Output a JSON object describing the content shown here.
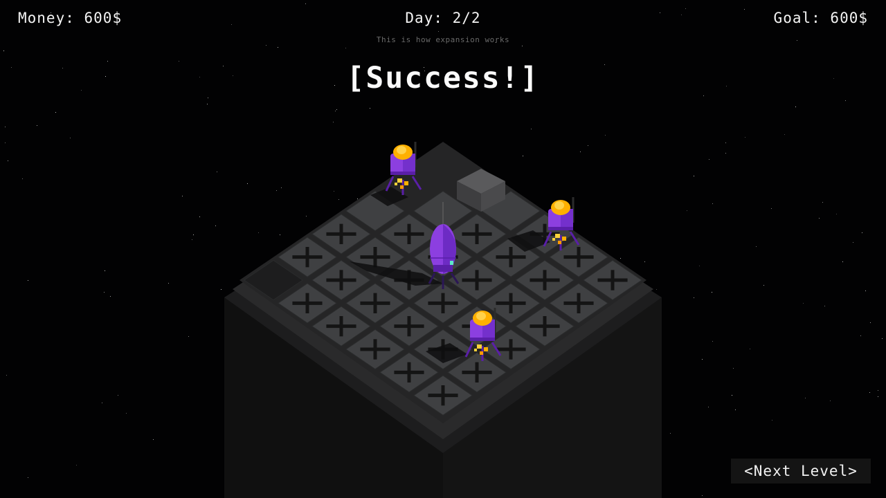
{
  "hud": {
    "money_label": "Money:",
    "money_value": "600$",
    "day_label": "Day:",
    "day_value": "2/2",
    "goal_label": "Goal:",
    "goal_value": "600$",
    "subtitle": "This is how expansion works"
  },
  "result_text": "[Success!]",
  "next_level_label": "<Next Level>",
  "board": {
    "size": 6,
    "unlocked_tiles": 19,
    "marked_tiles": 17,
    "block_count": 1,
    "pad_count": 1
  },
  "units": {
    "rocket_count": 1,
    "drone_count": 3
  },
  "colors": {
    "background": "#020203",
    "tower": "#151515",
    "tile": "#3f4042",
    "tile_edge": "#2a2b2c",
    "tile_mark": "#141414",
    "block": "#4a4a4c",
    "unit_purple": "#8c3fe0",
    "unit_purple_dark": "#5a1fa8",
    "orb": "#ffb000",
    "flame": "#ffd23a",
    "text": "#f4f4f4",
    "subtitle": "#6a6a6a",
    "button_bg": "#141414"
  },
  "icons": {
    "rocket": "rocket-icon",
    "drone": "drone-icon",
    "block": "stone-block-icon"
  }
}
